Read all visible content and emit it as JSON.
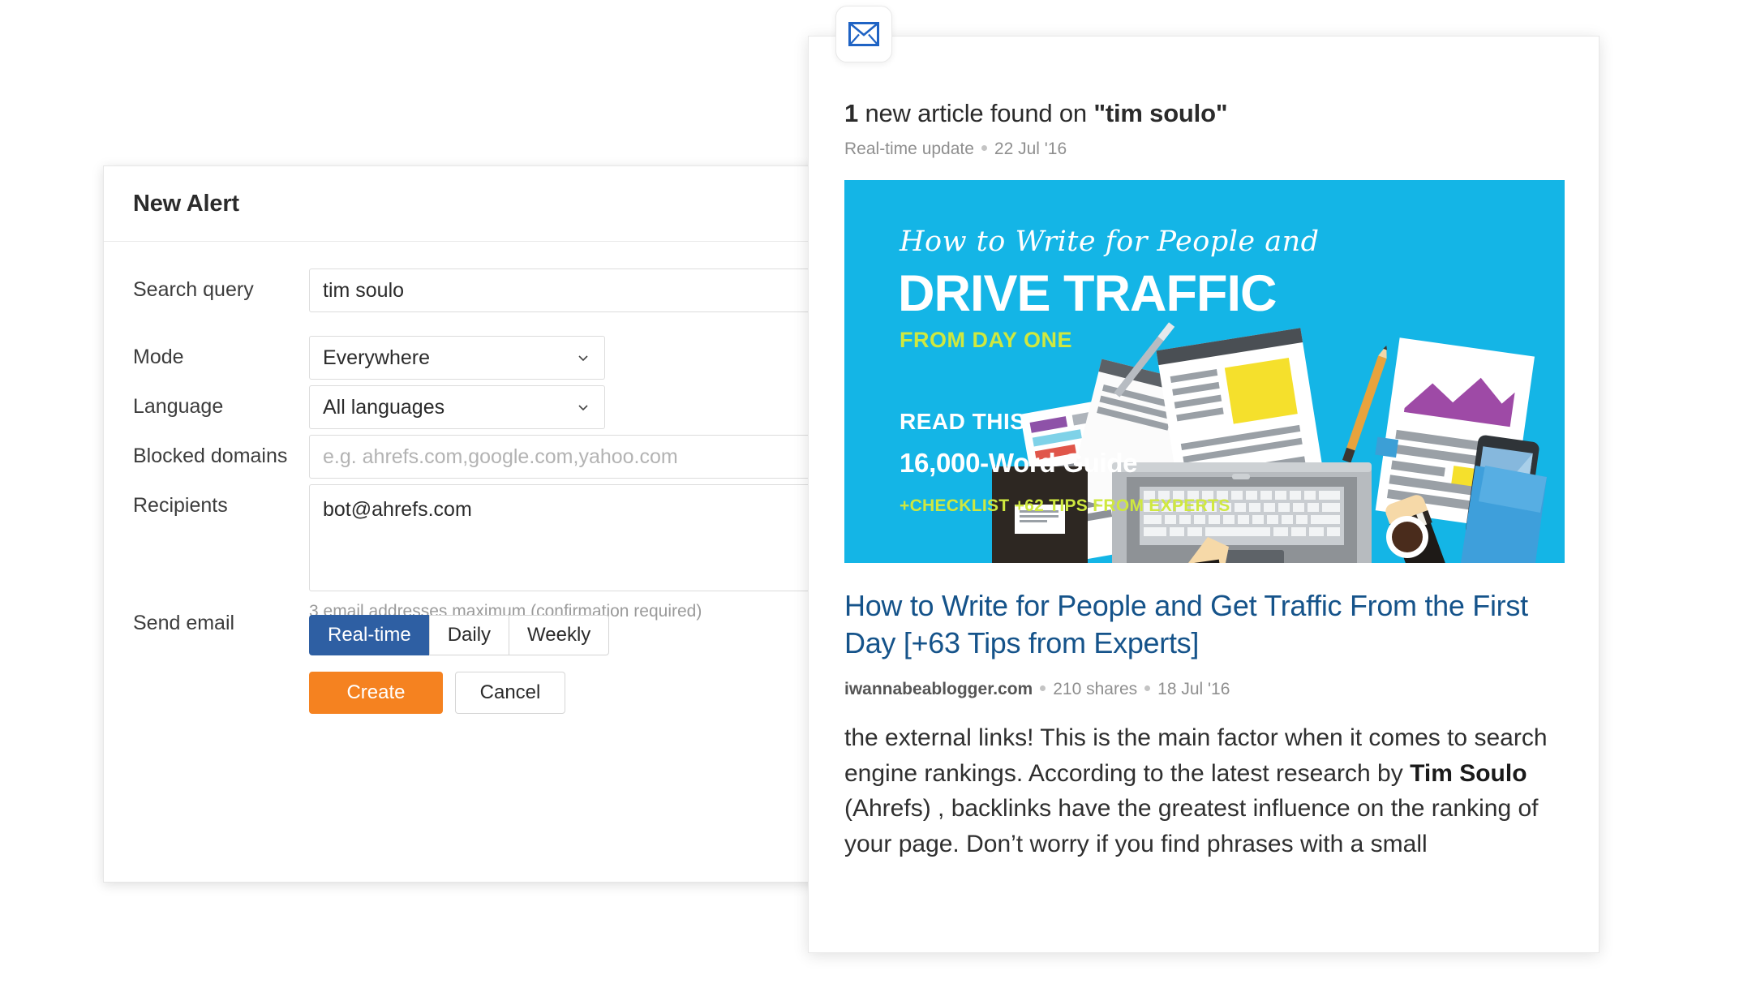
{
  "dialog": {
    "title": "New Alert",
    "fields": {
      "search_query": {
        "label": "Search query",
        "value": "tim soulo"
      },
      "mode": {
        "label": "Mode",
        "value": "Everywhere"
      },
      "language": {
        "label": "Language",
        "value": "All languages"
      },
      "blocked_domains": {
        "label": "Blocked domains",
        "value": "",
        "placeholder": "e.g. ahrefs.com,google.com,yahoo.com"
      },
      "recipients": {
        "label": "Recipients",
        "value": "bot@ahrefs.com",
        "help": "3 email addresses maximum (confirmation required)"
      },
      "send_email": {
        "label": "Send email",
        "options": [
          "Real-time",
          "Daily",
          "Weekly"
        ],
        "selected": "Real-time"
      }
    },
    "buttons": {
      "create": "Create",
      "cancel": "Cancel"
    },
    "colors": {
      "primary": "#f58220",
      "accent": "#2e5fa3"
    }
  },
  "notification": {
    "icon": "envelope-icon",
    "headline_count": "1",
    "headline_mid": " new article found on ",
    "headline_query": "\"tim soulo\"",
    "meta_type": "Real-time update",
    "meta_date": "22 Jul '16",
    "banner": {
      "script_line": "How to Write for People and",
      "headline": "DRIVE TRAFFIC",
      "subhead": "FROM DAY ONE",
      "read_this": "READ THIS",
      "guide": "16,000-Word Guide",
      "checklist": "+CHECKLIST +62 TIPS FROM EXPERTS",
      "bg_color": "#14b5e6",
      "accent_color": "#cfe83f"
    },
    "article": {
      "title": "How to Write for People and Get Traffic From the First Day [+63 Tips from Experts]",
      "source": "iwannabeablogger.com",
      "shares": "210 shares",
      "date": "18 Jul '16",
      "snippet_1": "the external links! This is the main factor when it comes to search engine rankings. According to the latest research by ",
      "snippet_bold": "Tim Soulo",
      "snippet_2": " (Ahrefs) , backlinks have the greatest influence on the ranking of your page. Don’t worry if you find phrases with a small",
      "link_color": "#15538a"
    }
  }
}
